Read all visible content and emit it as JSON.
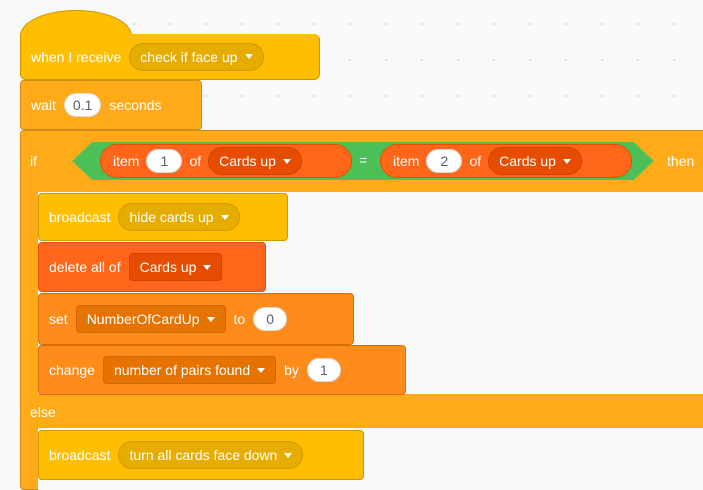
{
  "receive": {
    "label": "when I receive",
    "message": "check if face up"
  },
  "wait": {
    "label": "wait",
    "value": "0.1",
    "suffix": "seconds"
  },
  "if_block": {
    "if_label": "if",
    "then_label": "then",
    "else_label": "else",
    "left_item": {
      "item_label": "item",
      "index": "1",
      "of_label": "of",
      "list": "Cards up"
    },
    "operator": "=",
    "right_item": {
      "item_label": "item",
      "index": "2",
      "of_label": "of",
      "list": "Cards up"
    }
  },
  "broadcast1": {
    "label": "broadcast",
    "message": "hide cards up"
  },
  "delete_all": {
    "label": "delete all of",
    "list": "Cards up"
  },
  "set_var": {
    "label": "set",
    "variable": "NumberOfCardUp",
    "to_label": "to",
    "value": "0"
  },
  "change_var": {
    "label": "change",
    "variable": "number of pairs found",
    "by_label": "by",
    "value": "1"
  },
  "broadcast2": {
    "label": "broadcast",
    "message": "turn all cards face down"
  },
  "colors": {
    "events": "#ffbf00",
    "control": "#ffab19",
    "list": "#ff661a",
    "variables": "#ff8c1a",
    "operators": "#59c059",
    "canvas": "#f9f9f9"
  }
}
